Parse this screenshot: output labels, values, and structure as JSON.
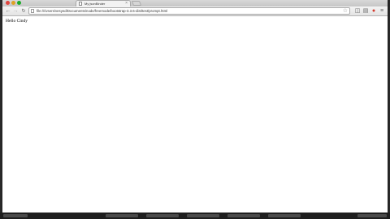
{
  "browser": {
    "tab": {
      "title": "My jsonBinder"
    },
    "address_bar": {
      "url": "file:///Users/vesyed/Documents/node/freemode/bootstrap-3.3.6-dist/test/prompt.html"
    },
    "icons": [
      "back-arrow-icon",
      "forward-arrow-icon",
      "reload-icon",
      "star-icon",
      "extension-icon",
      "reading-list-icon",
      "record-icon",
      "menu-icon"
    ]
  },
  "page": {
    "text": "Hello Cindy"
  },
  "colors": {
    "background": "#ffffff",
    "chrome": "#e8e8e8",
    "desktop": "#2b2b2b"
  }
}
